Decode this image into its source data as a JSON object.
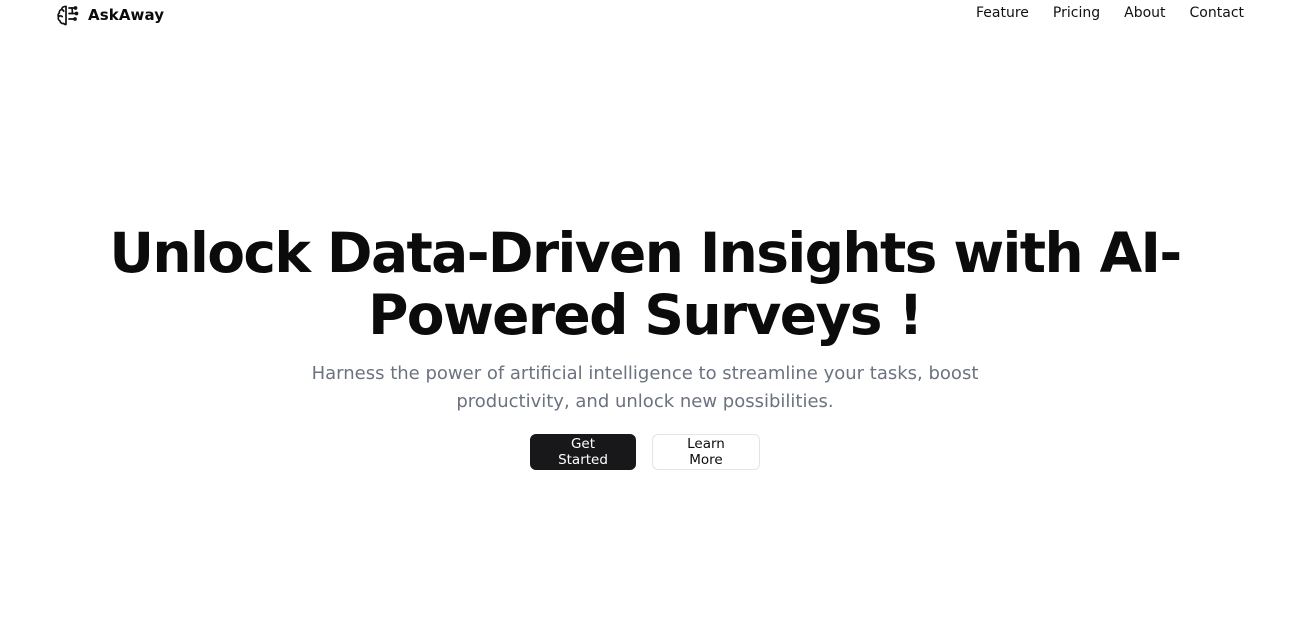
{
  "header": {
    "brand_name": "AskAway",
    "brand_icon": "brain-icon",
    "nav": {
      "feature": "Feature",
      "pricing": "Pricing",
      "about": "About",
      "contact": "Contact"
    }
  },
  "hero": {
    "title": "Unlock Data-Driven Insights with AI-Powered Surveys !",
    "subtitle": "Harness the power of artificial intelligence to streamline your tasks, boost productivity, and unlock new possibilities.",
    "primary_cta": "Get Started",
    "secondary_cta": "Learn More"
  },
  "colors": {
    "primary_button": "#18181b",
    "subtitle_text": "#6b7280",
    "secondary_border": "#e4e4e7"
  }
}
